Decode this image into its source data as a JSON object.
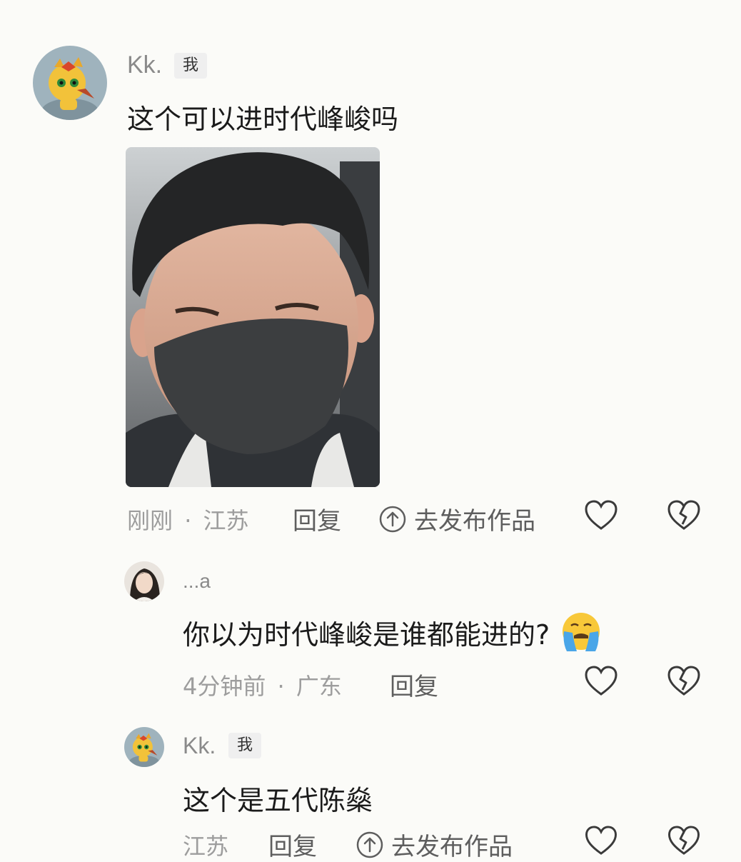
{
  "comments": [
    {
      "user": "Kk.",
      "tag": "我",
      "text": "这个可以进时代峰峻吗",
      "time": "刚刚",
      "separator": "·",
      "location": "江苏",
      "reply_label": "回复",
      "post_label": "去发布作品"
    },
    {
      "user": "...a",
      "text": "你以为时代峰峻是谁都能进的?",
      "emoji": "crying-face-emoji",
      "time": "4分钟前",
      "separator": "·",
      "location": "广东",
      "reply_label": "回复"
    },
    {
      "user": "Kk.",
      "tag": "我",
      "text": "这个是五代陈燊",
      "location": "江苏",
      "reply_label": "回复",
      "post_label": "去发布作品"
    }
  ],
  "icons": {
    "like": "heart-outline-icon",
    "dislike": "broken-heart-icon",
    "post": "upload-circle-icon"
  },
  "colors": {
    "background": "#fbfbf8",
    "meta_text": "#9d9d9d",
    "action_text": "#5e5e5e"
  }
}
